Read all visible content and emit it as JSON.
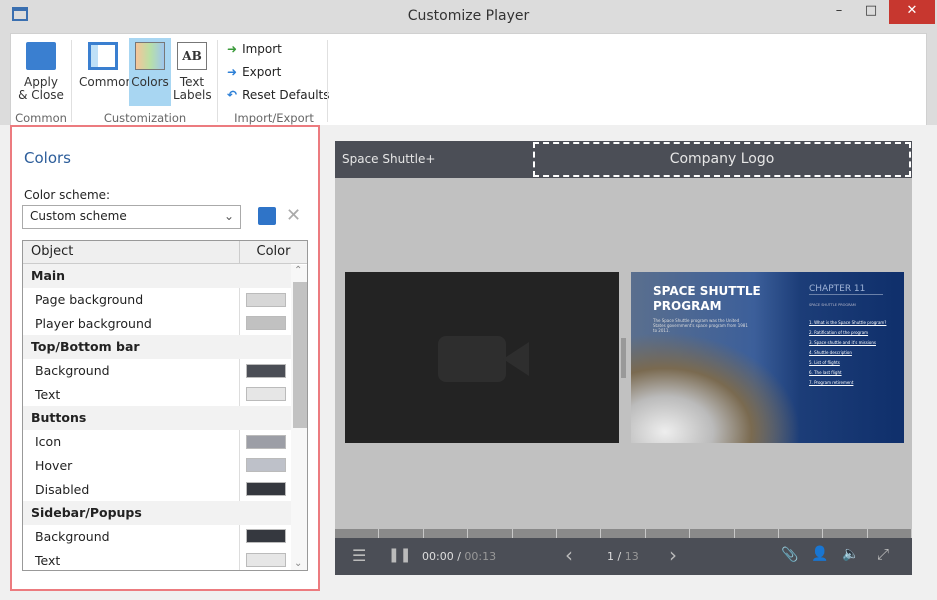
{
  "window": {
    "title": "Customize Player",
    "minimize": "–",
    "maximize": "□",
    "close": "✕"
  },
  "ribbon": {
    "apply_close": "Apply\n& Close",
    "group_common": "Common",
    "common": "Common",
    "colors": "Colors",
    "text_labels": "Text\nLabels",
    "group_customization": "Customization",
    "import": "Import",
    "export": "Export",
    "reset_defaults": "Reset Defaults",
    "group_import_export": "Import/Export"
  },
  "panel": {
    "title": "Colors",
    "scheme_label": "Color scheme:",
    "scheme_value": "Custom scheme",
    "col_object": "Object",
    "col_color": "Color",
    "groups": [
      {
        "name": "Main",
        "items": [
          {
            "label": "Page background",
            "color": "#d7d7d7"
          },
          {
            "label": "Player background",
            "color": "#c1c1c1"
          }
        ]
      },
      {
        "name": "Top/Bottom bar",
        "items": [
          {
            "label": "Background",
            "color": "#4b4e56"
          },
          {
            "label": "Text",
            "color": "#e6e6e6"
          }
        ]
      },
      {
        "name": "Buttons",
        "items": [
          {
            "label": "Icon",
            "color": "#9c9ea6"
          },
          {
            "label": "Hover",
            "color": "#bec1c9"
          },
          {
            "label": "Disabled",
            "color": "#35383f"
          }
        ]
      },
      {
        "name": "Sidebar/Popups",
        "items": [
          {
            "label": "Background",
            "color": "#35383f"
          },
          {
            "label": "Text",
            "color": "#e6e6e6"
          }
        ]
      }
    ]
  },
  "player": {
    "title": "Space Shuttle+",
    "logo": "Company Logo",
    "slide": {
      "heading": "SPACE SHUTTLE PROGRAM",
      "body": "The Space Shuttle program was the United States government's space program from 1981 to 2011.",
      "chapter": "CHAPTER 11",
      "chapter_sub": "SPACE SHUTTLE PROGRAM",
      "toc": [
        "1. What is the Space Shuttle program?",
        "2. Ratification of the program",
        "3. Space shuttle and it's missions",
        "4. Shuttle description",
        "5. List of flights",
        "6. The last flight",
        "7. Program retirement"
      ]
    },
    "time_current": "00:00",
    "time_sep": "/",
    "time_total": "00:13",
    "page_current": "1",
    "page_sep": "/",
    "page_total": "13"
  }
}
